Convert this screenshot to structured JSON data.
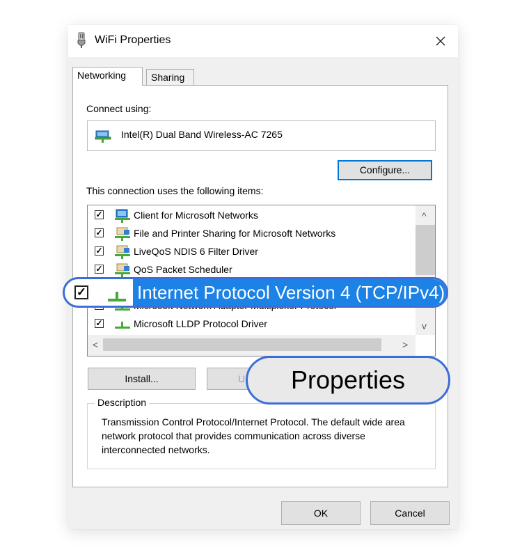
{
  "window": {
    "title": "WiFi Properties",
    "close_label": "✕"
  },
  "tabs": [
    {
      "label": "Networking",
      "active": true
    },
    {
      "label": "Sharing",
      "active": false
    }
  ],
  "connect": {
    "label": "Connect using:",
    "adapter": "Intel(R) Dual Band Wireless-AC 7265",
    "configure_label": "Configure..."
  },
  "items": {
    "label": "This connection uses the following items:",
    "list": [
      {
        "label": "Client for Microsoft Networks",
        "checked": true,
        "icon": "network-client-icon"
      },
      {
        "label": "File and Printer Sharing for Microsoft Networks",
        "checked": true,
        "icon": "network-service-icon"
      },
      {
        "label": "LiveQoS NDIS 6 Filter Driver",
        "checked": true,
        "icon": "network-service-icon"
      },
      {
        "label": "QoS Packet Scheduler",
        "checked": true,
        "icon": "network-service-icon"
      },
      {
        "label": "Internet Protocol Version 4 (TCP/IPv4)",
        "checked": true,
        "icon": "protocol-icon",
        "selected": true
      },
      {
        "label": "Microsoft Network Adapter Multiplexor Protocol",
        "checked": false,
        "icon": "protocol-icon"
      },
      {
        "label": "Microsoft LLDP Protocol Driver",
        "checked": true,
        "icon": "protocol-icon"
      }
    ],
    "check_mark": "✓"
  },
  "buttons": {
    "install": "Install...",
    "uninstall": "U",
    "properties": "Properties",
    "ok": "OK",
    "cancel": "Cancel"
  },
  "description": {
    "legend": "Description",
    "text": "Transmission Control Protocol/Internet Protocol. The default wide area network protocol that provides communication across diverse interconnected networks."
  },
  "scroll_arrows": {
    "up": "^",
    "down": "v",
    "left": "<",
    "right": ">"
  },
  "colors": {
    "accent": "#1d82e6",
    "highlight_border": "#3b6ed9"
  }
}
